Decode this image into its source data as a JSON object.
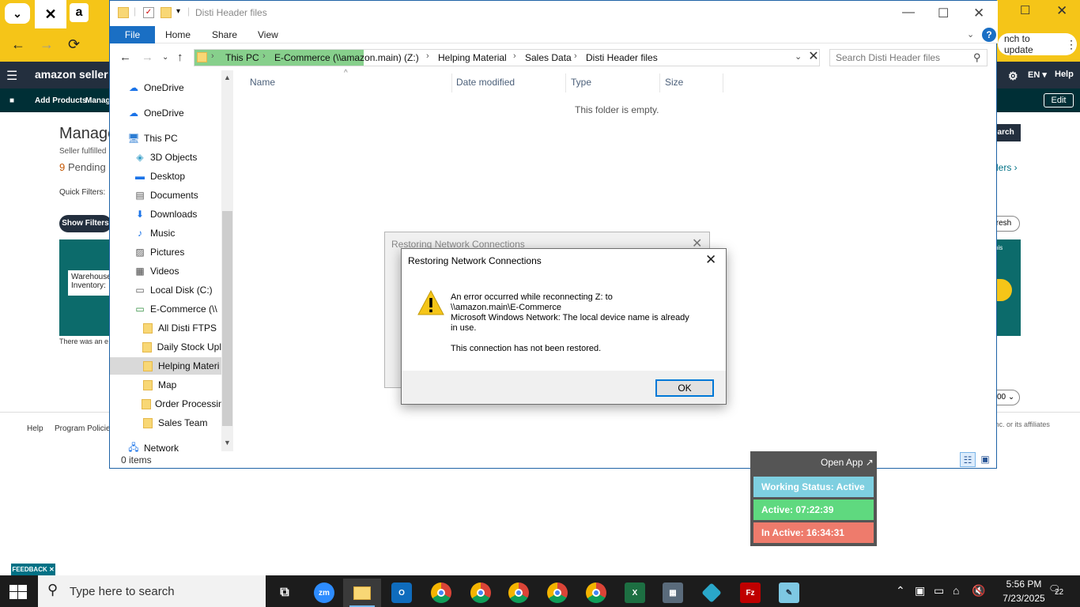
{
  "browser": {
    "tab_amazon_icon": "a",
    "update_label": "nch to update",
    "nav": {
      "back": "←",
      "forward": "→",
      "reload": "⟳"
    }
  },
  "amazon": {
    "logo": "amazon seller cent",
    "lang": "EN",
    "help": "Help",
    "add_products": "Add Products",
    "manage_short": "Manag",
    "edit": "Edit",
    "page_title": "Manage",
    "seller_fulfilled": "Seller fulfilled",
    "pending_count": "9",
    "pending_label": "Pending",
    "quick_filters": "Quick Filters:",
    "show_filters": "Show Filters",
    "banner_card": "Warehouse Inventory:",
    "search_btn": "earch",
    "orders_link": "ders ›",
    "refresh": "fresh",
    "banner_r_text": "nis",
    "error_text": "There was an e",
    "pager_value": "00",
    "footer": {
      "help": "Help",
      "program_policies": "Program Policies"
    },
    "affiliates": "Inc. or its affiliates",
    "feedback": "FEEDBACK ✕"
  },
  "explorer": {
    "title": "Disti Header files",
    "ribbon": {
      "file": "File",
      "home": "Home",
      "share": "Share",
      "view": "View"
    },
    "breadcrumbs": [
      "This PC",
      "E-Commerce (\\\\amazon.main) (Z:)",
      "Helping Material",
      "Sales Data",
      "Disti Header files"
    ],
    "search_placeholder": "Search Disti Header files",
    "nav_items": [
      {
        "label": "OneDrive",
        "icon": "cloud-icon",
        "indent": 0
      },
      {
        "label": "OneDrive",
        "icon": "cloud-icon",
        "indent": 0
      },
      {
        "label": "This PC",
        "icon": "computer-icon",
        "indent": 0
      },
      {
        "label": "3D Objects",
        "icon": "cube-icon",
        "indent": 1
      },
      {
        "label": "Desktop",
        "icon": "desktop-icon",
        "indent": 1
      },
      {
        "label": "Documents",
        "icon": "document-icon",
        "indent": 1
      },
      {
        "label": "Downloads",
        "icon": "download-icon",
        "indent": 1
      },
      {
        "label": "Music",
        "icon": "music-icon",
        "indent": 1
      },
      {
        "label": "Pictures",
        "icon": "picture-icon",
        "indent": 1
      },
      {
        "label": "Videos",
        "icon": "video-icon",
        "indent": 1
      },
      {
        "label": "Local Disk (C:)",
        "icon": "disk-icon",
        "indent": 1
      },
      {
        "label": "E-Commerce (\\\\",
        "icon": "network-drive-icon",
        "indent": 1
      },
      {
        "label": "All Disti FTPS",
        "icon": "folder-icon",
        "indent": 2
      },
      {
        "label": "Daily Stock Upl",
        "icon": "folder-icon",
        "indent": 2
      },
      {
        "label": "Helping Materi",
        "icon": "folder-icon",
        "indent": 2,
        "selected": true
      },
      {
        "label": "Map",
        "icon": "folder-icon",
        "indent": 2
      },
      {
        "label": "Order Processin",
        "icon": "folder-icon",
        "indent": 2
      },
      {
        "label": "Sales Team",
        "icon": "folder-icon",
        "indent": 2
      },
      {
        "label": "Network",
        "icon": "network-icon",
        "indent": 0
      }
    ],
    "columns": {
      "name": "Name",
      "date_modified": "Date modified",
      "type": "Type",
      "size": "Size"
    },
    "empty_message": "This folder is empty.",
    "status": "0 items"
  },
  "dialog_back": {
    "title": "Restoring Network Connections"
  },
  "dialog": {
    "title": "Restoring Network Connections",
    "line1": "An error occurred while reconnecting Z: to",
    "line2": "\\\\amazon.main\\E-Commerce",
    "line3": "Microsoft Windows Network: The local device name is already",
    "line4": "in use.",
    "line5": "This connection has not been restored.",
    "ok": "OK"
  },
  "widget": {
    "open_app": "Open App ↗",
    "working_status": "Working Status: Active",
    "active": "Active: 07:22:39",
    "inactive": "In Active: 16:34:31"
  },
  "taskbar": {
    "search_placeholder": "Type here to search",
    "time": "5:56 PM",
    "date": "7/23/2025",
    "notifications": "22"
  }
}
